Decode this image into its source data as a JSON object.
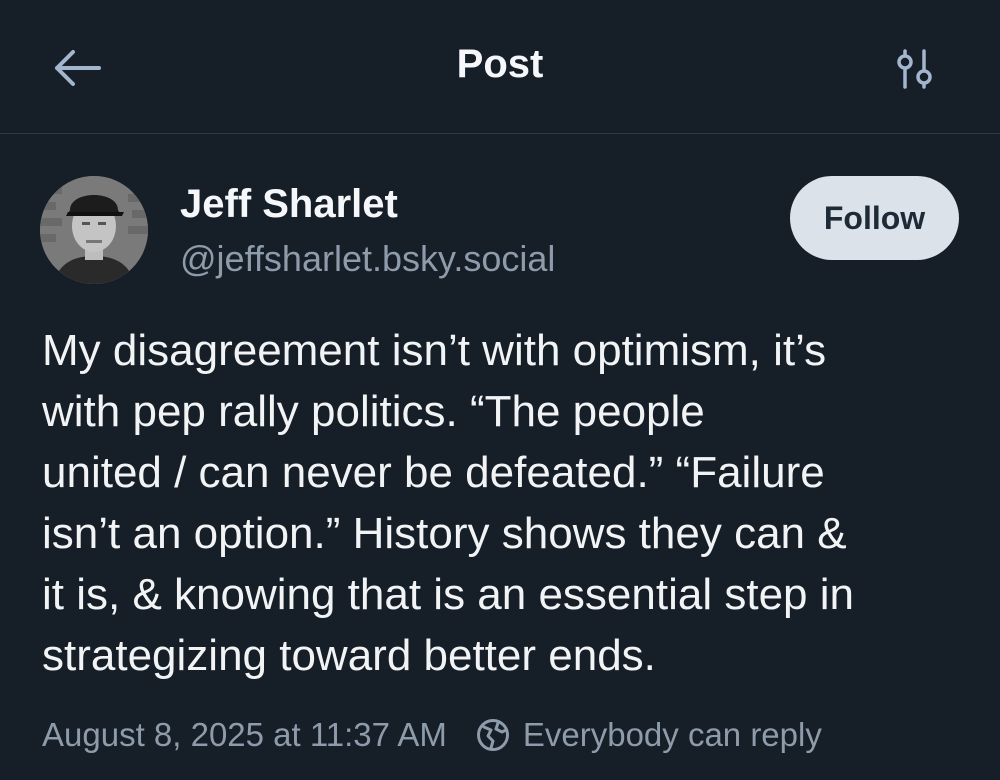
{
  "header": {
    "title": "Post",
    "back_icon": "arrow-left-icon",
    "settings_icon": "sliders-icon"
  },
  "post": {
    "author": {
      "name": "Jeff Sharlet",
      "handle": "@jeffsharlet.bsky.social"
    },
    "follow_label": "Follow",
    "text_lines": [
      "My disagreement isn’t with optimism, it’s",
      "with pep rally politics. “The people",
      "united / can never be defeated.” “Failure",
      "isn’t an option.” History shows they can &",
      "it is, & knowing that is an essential step in",
      "strategizing toward better ends."
    ],
    "timestamp": "August 8, 2025 at 11:37 AM",
    "reply_setting": "Everybody can reply"
  },
  "colors": {
    "background": "#161e27",
    "primary_text": "#f1f3f5",
    "secondary_text": "#8d9bab",
    "follow_button_bg": "#dce2ea",
    "follow_button_text": "#1d2a38"
  }
}
